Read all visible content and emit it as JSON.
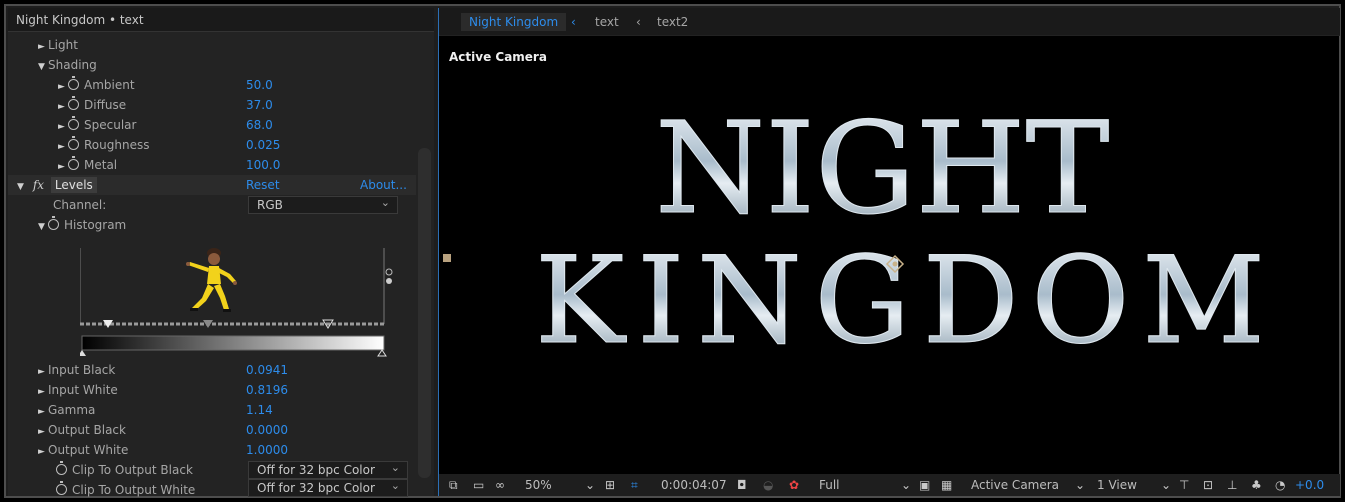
{
  "panel_title": "Night Kingdom • text",
  "effects": {
    "light_label": "Light",
    "shading_label": "Shading",
    "shading_props": [
      {
        "label": "Ambient",
        "value": "50.0"
      },
      {
        "label": "Diffuse",
        "value": "37.0"
      },
      {
        "label": "Specular",
        "value": "68.0"
      },
      {
        "label": "Roughness",
        "value": "0.025"
      },
      {
        "label": "Metal",
        "value": "100.0"
      }
    ],
    "fx_icon": "fx",
    "levels_label": "Levels",
    "reset_label": "Reset",
    "about_label": "About...",
    "channel_label": "Channel:",
    "channel_value": "RGB",
    "histogram_label": "Histogram",
    "level_props": [
      {
        "label": "Input Black",
        "value": "0.0941"
      },
      {
        "label": "Input White",
        "value": "0.8196"
      },
      {
        "label": "Gamma",
        "value": "1.14"
      },
      {
        "label": "Output Black",
        "value": "0.0000"
      },
      {
        "label": "Output White",
        "value": "1.0000"
      }
    ],
    "clip_black_label": "Clip To Output Black",
    "clip_black_value": "Off for 32 bpc Color",
    "clip_white_label": "Clip To Output White",
    "clip_white_value": "Off for 32 bpc Color"
  },
  "viewer": {
    "tabs": [
      "Night Kingdom",
      "text",
      "text2"
    ],
    "active_camera_label": "Active Camera",
    "title_line1": "NIGHT",
    "title_line2": "KINGDOM",
    "accent_color": "#2d8ceb"
  },
  "bottom_bar": {
    "zoom": "50%",
    "timecode": "0:00:04:07",
    "resolution": "Full",
    "camera": "Active Camera",
    "views": "1 View",
    "exposure": "+0.0"
  }
}
